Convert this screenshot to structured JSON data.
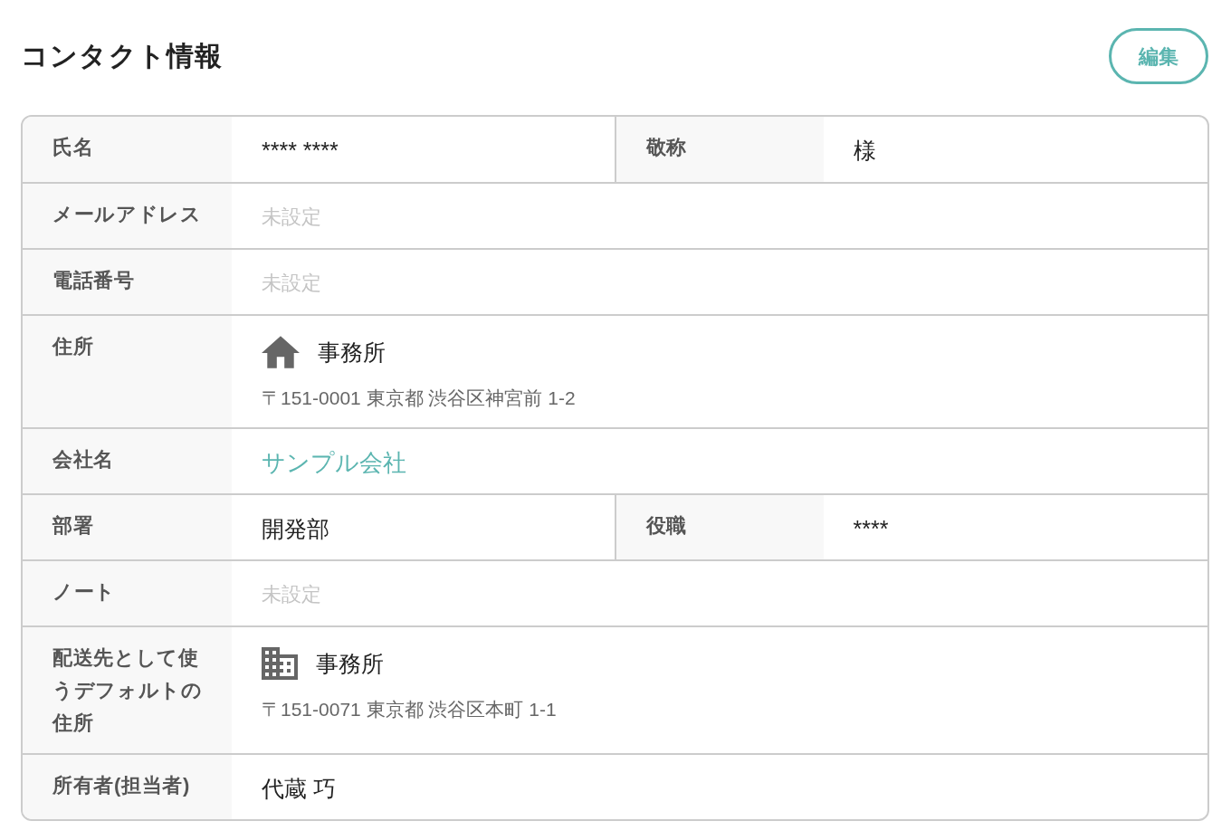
{
  "title": "コンタクト情報",
  "edit_button": {
    "label": "編集"
  },
  "rows": [
    {
      "fields": [
        {
          "label": "氏名",
          "value": {
            "kind": "text",
            "text": "**** ****"
          }
        },
        {
          "label": "敬称",
          "value": {
            "kind": "text",
            "text": "様"
          }
        }
      ]
    },
    {
      "fields": [
        {
          "label": "メールアドレス",
          "value": {
            "kind": "unset",
            "text": "未設定"
          }
        }
      ]
    },
    {
      "fields": [
        {
          "label": "電話番号",
          "value": {
            "kind": "unset",
            "text": "未設定"
          }
        }
      ]
    },
    {
      "fields": [
        {
          "label": "住所",
          "value": {
            "kind": "house",
            "name": "事務所",
            "line": "〒151-0001 東京都 渋谷区神宮前 1-2"
          }
        }
      ]
    },
    {
      "fields": [
        {
          "label": "会社名",
          "value": {
            "kind": "link",
            "text": "サンプル会社"
          }
        }
      ]
    },
    {
      "fields": [
        {
          "label": "部署",
          "value": {
            "kind": "text",
            "text": "開発部"
          }
        },
        {
          "label": "役職",
          "value": {
            "kind": "text",
            "text": "****"
          }
        }
      ]
    },
    {
      "fields": [
        {
          "label": "ノート",
          "value": {
            "kind": "unset",
            "text": "未設定"
          }
        }
      ]
    },
    {
      "fields": [
        {
          "label": "配送先として使うデフォルトの住所",
          "value": {
            "kind": "building",
            "name": "事務所",
            "line": "〒151-0071 東京都 渋谷区本町 1-1"
          }
        }
      ]
    },
    {
      "fields": [
        {
          "label": "所有者(担当者)",
          "value": {
            "kind": "text",
            "text": "代蔵 巧"
          }
        }
      ]
    }
  ]
}
